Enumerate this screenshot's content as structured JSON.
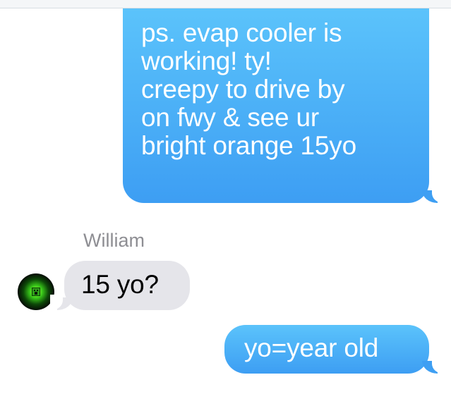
{
  "conversation": {
    "messages": [
      {
        "direction": "sent",
        "text": "ps.  evap cooler is\nworking!  ty!\ncreepy to drive by\non fwy & see ur\nbright orange 15yo"
      },
      {
        "direction": "received",
        "sender": "William",
        "avatar_icon": "creeper-avatar-icon",
        "text": "15 yo?"
      },
      {
        "direction": "sent",
        "text": "yo=year old"
      }
    ]
  },
  "colors": {
    "sent_bubble": "#3d9ef3",
    "received_bubble": "#e5e5ea",
    "sender_name": "#8e8e93",
    "avatar_glow": "#39c81a"
  }
}
